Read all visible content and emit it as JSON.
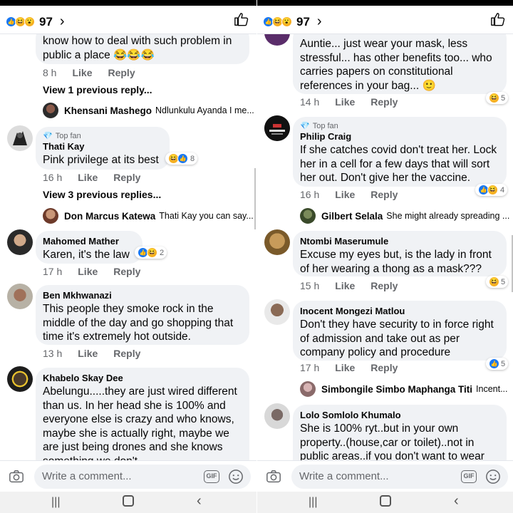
{
  "header": {
    "reaction_count": "97"
  },
  "footer": {
    "placeholder": "Write a comment...",
    "gif_label": "GIF"
  },
  "left": {
    "c0": {
      "text": "know how to deal with such problem in public a place 😂😂😂",
      "time": "8 h",
      "like": "Like",
      "reply": "Reply"
    },
    "c0_prev": "View 1 previous reply...",
    "c0_reply": {
      "name": "Khensani Mashego",
      "text": "Ndlunkulu Ayanda I me..."
    },
    "c1": {
      "badge": "Top fan",
      "name": "Thati Kay",
      "text": "Pink privilege at its best",
      "time": "16 h",
      "like": "Like",
      "reply": "Reply",
      "reactions": "8"
    },
    "c1_prev": "View 3 previous replies...",
    "c1_reply": {
      "name": "Don Marcus Katewa",
      "text": "Thati Kay you can say..."
    },
    "c2": {
      "name": "Mahomed Mather",
      "text": "Karen, it's the law",
      "time": "17 h",
      "like": "Like",
      "reply": "Reply",
      "reactions": "2"
    },
    "c3": {
      "name": "Ben Mkhwanazi",
      "text": "This people they smoke rock in the middle of the day and go shopping that time it's extremely hot outside.",
      "time": "13 h",
      "like": "Like",
      "reply": "Reply"
    },
    "c4": {
      "name": "Khabelo Skay Dee",
      "text": "Abelungu.....they are just wired different than us. In her head she is 100% and everyone else is crazy and who knows, maybe she is actually right, maybe we are just being drones and she knows something we don't"
    }
  },
  "right": {
    "c0": {
      "text": "Auntie... just wear your mask, less stressful... has other benefits too... who carries papers on constitutional references in your bag... 🙂",
      "time": "14 h",
      "like": "Like",
      "reply": "Reply",
      "reactions": "5"
    },
    "c1": {
      "badge": "Top fan",
      "name": "Philip Craig",
      "text": "If she catches covid don't treat her.  Lock her in a cell for a few days that will sort her out.  Don't give her the vaccine.",
      "time": "16 h",
      "like": "Like",
      "reply": "Reply",
      "reactions": "4"
    },
    "c1_reply": {
      "name": "Gilbert Selala",
      "text": "She might already spreading ..."
    },
    "c2": {
      "name": "Ntombi Maserumule",
      "text": "Excuse my eyes but, is the lady in front of her wearing a thong as a mask???",
      "time": "15 h",
      "like": "Like",
      "reply": "Reply",
      "reactions": "5"
    },
    "c3": {
      "name": "Inocent Mongezi Matlou",
      "text": "Don't they have security to in force right of admission and take out as per company policy and procedure",
      "time": "17 h",
      "like": "Like",
      "reply": "Reply",
      "reactions": "5"
    },
    "c3_reply": {
      "name": "Simbongile Simbo Maphanga Titi",
      "text": "Incent..."
    },
    "c4": {
      "name": "Lolo Somlolo Khumalo",
      "text": "She is 100% ryt..but in your own property..(house,car or toilet)..not in public areas..if you don't want to wear"
    }
  },
  "colors": {
    "bubble": "#f0f2f5",
    "meta": "#65676b",
    "like_blue": "#1877f2",
    "haha_yellow": "#f7b125"
  }
}
